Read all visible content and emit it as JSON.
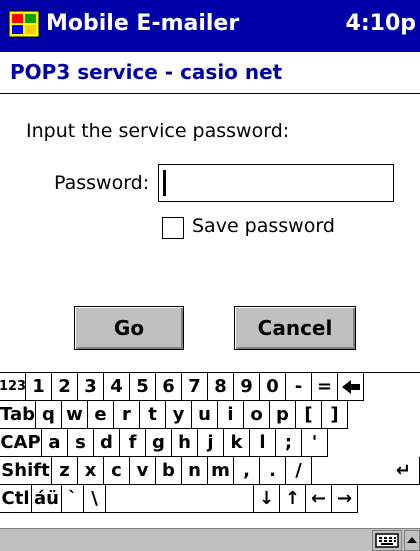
{
  "titlebar": {
    "app_title": "Mobile E-mailer",
    "clock": "4:10p"
  },
  "subheader": {
    "title": "POP3 service - casio net"
  },
  "form": {
    "prompt": "Input the service password:",
    "password_label": "Password:",
    "password_value": "",
    "save_password_label": "Save password",
    "save_password_checked": false
  },
  "buttons": {
    "go_label": "Go",
    "cancel_label": "Cancel"
  },
  "keyboard": {
    "rows": [
      [
        "123",
        "1",
        "2",
        "3",
        "4",
        "5",
        "6",
        "7",
        "8",
        "9",
        "0",
        "-",
        "=",
        "◆"
      ],
      [
        "Tab",
        "q",
        "w",
        "e",
        "r",
        "t",
        "y",
        "u",
        "i",
        "o",
        "p",
        "[",
        "]"
      ],
      [
        "CAP",
        "a",
        "s",
        "d",
        "f",
        "g",
        "h",
        "j",
        "k",
        "l",
        ";",
        "'"
      ],
      [
        "Shift",
        "z",
        "x",
        "c",
        "v",
        "b",
        "n",
        "m",
        ",",
        ".",
        "/",
        "↵"
      ],
      [
        "Ctl",
        "áü",
        "`",
        "\\",
        "",
        "↓",
        "↑",
        "←",
        "→"
      ]
    ]
  },
  "bottombar": {
    "icons": [
      "keyboard-icon",
      "up-arrow-icon"
    ]
  }
}
